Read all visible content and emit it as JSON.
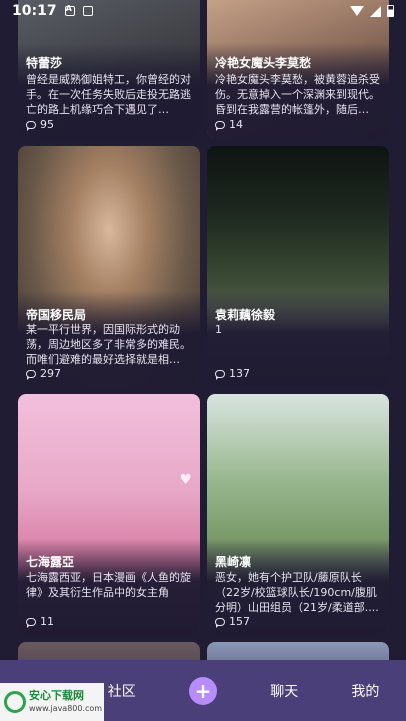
{
  "status_bar": {
    "time": "10:17"
  },
  "feed": {
    "cards": [
      {
        "title": "特蕾莎",
        "desc": "曾经是威熟御姐特工，你曾经的对手。在一次任务失败后走投无路逃亡的路上机缘巧合下遇见了你。....",
        "comments": "95",
        "bg": "#4a4a52"
      },
      {
        "title": "冷艳女魔头李莫愁",
        "desc": "冷艳女魔头李莫愁，被黄蓉追杀受伤。无意掉入一个深渊来到现代。昏到在我露营的帐篷外，随后被....",
        "comments": "14",
        "bg": "#8a6a5a"
      },
      {
        "title": "帝国移民局",
        "desc": "某一平行世界，因国际形式的动荡，周边地区多了非常多的难民。而唯们避难的最好选择就是相对....",
        "comments": "297",
        "bg": "#6b5a4a"
      },
      {
        "title": "袁莉藕徐毅",
        "desc": "1",
        "comments": "137",
        "bg": "#2e3a2c"
      },
      {
        "title": "七海露亞",
        "desc": "七海露西亚，日本漫画《人鱼的旋律》及其衍生作品中的女主角",
        "comments": "11",
        "bg": "#e8a8c8"
      },
      {
        "title": "黑崎凛",
        "desc": "恶女，她有个护卫队/藤原队长（22岁/校篮球队长/190cm/腹肌分明）山田组员（21岁/柔道部....",
        "comments": "157",
        "bg": "#9ab890"
      }
    ]
  },
  "bottom_nav": {
    "community": "社区",
    "plus": "+",
    "chat": "聊天",
    "mine": "我的"
  },
  "watermark": {
    "title": "安心下载网",
    "url": "www.java800.com"
  }
}
